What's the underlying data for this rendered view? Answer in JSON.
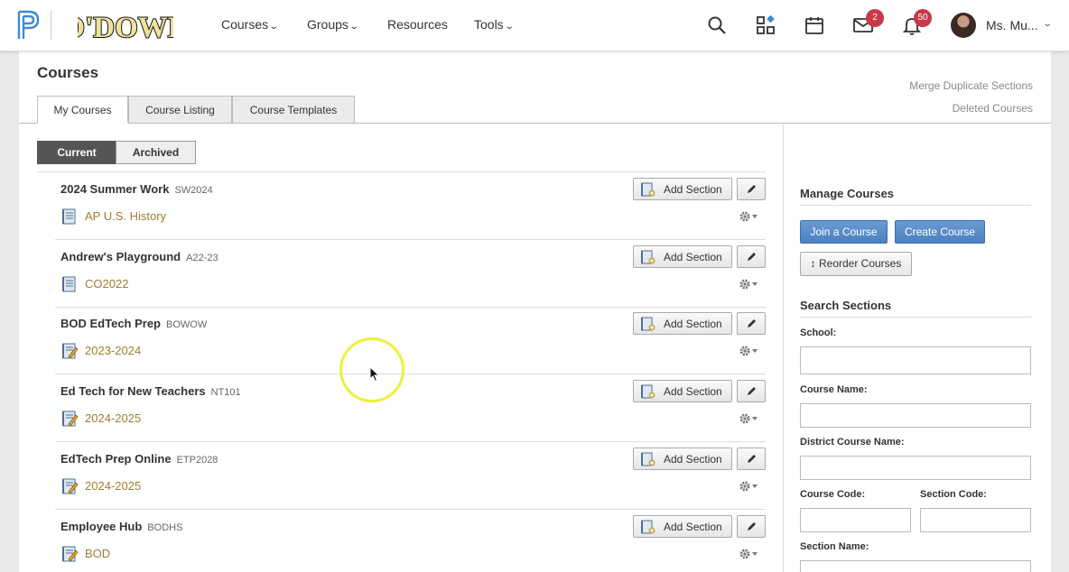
{
  "nav": {
    "brand": "O'DOWD",
    "menus": [
      {
        "label": "Courses",
        "has_dropdown": true
      },
      {
        "label": "Groups",
        "has_dropdown": true
      },
      {
        "label": "Resources",
        "has_dropdown": false
      },
      {
        "label": "Tools",
        "has_dropdown": true
      }
    ],
    "icons": [
      "search-icon",
      "apps-icon",
      "calendar-icon",
      "mail-icon",
      "bell-icon"
    ],
    "mail_badge": "2",
    "notification_badge": "50",
    "user_name": "Ms. Mu...",
    "badge_color": "#c9384a"
  },
  "page": {
    "title": "Courses",
    "tabs": [
      "My Courses",
      "Course Listing",
      "Course Templates"
    ],
    "active_tab": "My Courses",
    "links": [
      "Merge Duplicate Sections",
      "Deleted Courses"
    ],
    "toggle": {
      "current": "Current",
      "archived": "Archived",
      "selected": "Current"
    }
  },
  "courses": [
    {
      "name": "2024 Summer Work",
      "code": "SW2024",
      "section": "AP U.S. History",
      "section_icon": "course-notebook-icon"
    },
    {
      "name": "Andrew's Playground",
      "code": "A22-23",
      "section": "CO2022",
      "section_icon": "course-notebook-icon"
    },
    {
      "name": "BOD EdTech Prep",
      "code": "BOWOW",
      "section": "2023-2024",
      "section_icon": "course-notebook-pencil-icon"
    },
    {
      "name": "Ed Tech for New Teachers",
      "code": "NT101",
      "section": "2024-2025",
      "section_icon": "course-notebook-pencil-icon"
    },
    {
      "name": "EdTech Prep Online",
      "code": "ETP2028",
      "section": "2024-2025",
      "section_icon": "course-notebook-pencil-icon"
    },
    {
      "name": "Employee Hub",
      "code": "BODHS",
      "section": "BOD",
      "section_icon": "course-notebook-pencil-icon"
    }
  ],
  "row_actions": {
    "add_section": "Add Section"
  },
  "sidebar": {
    "manage_heading": "Manage Courses",
    "join_button": "Join a Course",
    "create_button": "Create Course",
    "reorder_button": "↕ Reorder Courses",
    "search_heading": "Search Sections",
    "fields": {
      "school": "School:",
      "course_name": "Course Name:",
      "district_course_name": "District Course Name:",
      "course_code": "Course Code:",
      "section_code": "Section Code:",
      "section_name": "Section Name:"
    }
  },
  "colors": {
    "accent_blue": "#4c7fbf",
    "section_link": "#a07d2f",
    "toggle_active": "#555555"
  }
}
